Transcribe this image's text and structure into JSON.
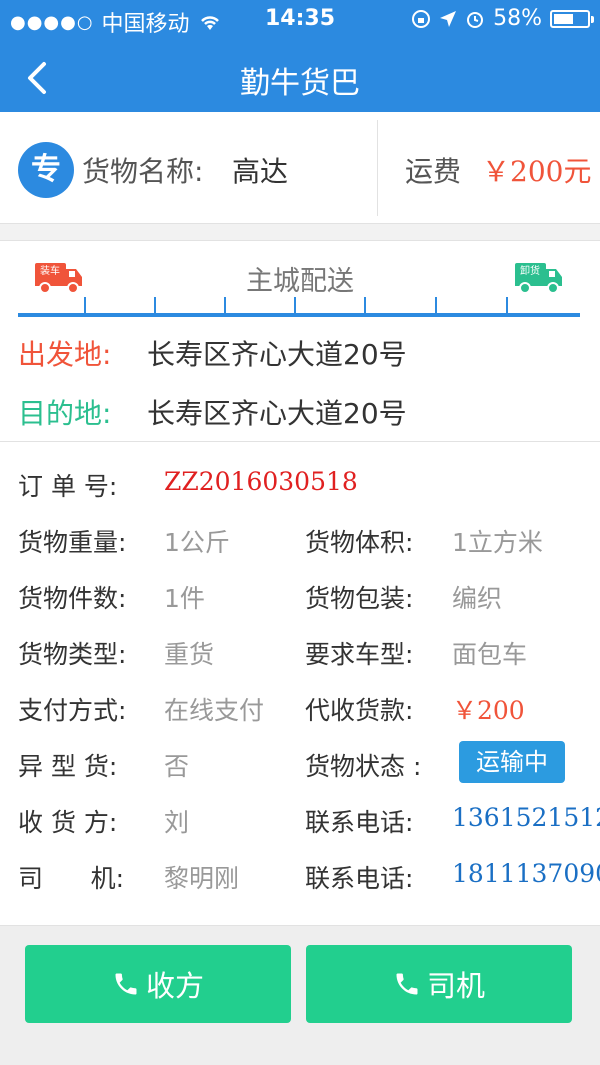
{
  "status_bar": {
    "carrier": "中国移动",
    "time": "14:35",
    "battery_text": "58%",
    "battery_level": 0.58
  },
  "nav": {
    "title": "勤牛货巴"
  },
  "summary": {
    "badge": "专",
    "goods_label": "货物名称:",
    "goods_name": "高达",
    "fee_label": "运费",
    "fee_value": "￥200元"
  },
  "route": {
    "load_label": "装车",
    "unload_label": "卸货",
    "delivery_type": "主城配送",
    "from_label": "出发地:",
    "from_value": "长寿区齐心大道20号",
    "to_label": "目的地:",
    "to_value": "长寿区齐心大道20号"
  },
  "info": {
    "order_label": "订 单 号:",
    "order_value": "ZZ2016030518",
    "weight_label": "货物重量:",
    "weight_value": "1公斤",
    "volume_label": "货物体积:",
    "volume_value": "1立方米",
    "count_label": "货物件数:",
    "count_value": "1件",
    "package_label": "货物包装:",
    "package_value": "编织",
    "type_label": "货物类型:",
    "type_value": "重货",
    "vehicle_label": "要求车型:",
    "vehicle_value": "面包车",
    "pay_label": "支付方式:",
    "pay_value": "在线支付",
    "cod_label": "代收货款:",
    "cod_value": "￥200",
    "odd_label": "异 型 货:",
    "odd_value": "否",
    "status_label": "货物状态 :",
    "status_value": "运输中",
    "receiver_label": "收 货 方:",
    "receiver_value": "刘",
    "receiver_phone_label": "联系电话:",
    "receiver_phone": "1361521512",
    "driver_label": "司      机:",
    "driver_value": "黎明刚",
    "driver_phone_label": "联系电话:",
    "driver_phone": "1811137090"
  },
  "actions": {
    "receiver_button": "收方",
    "driver_button": "司机"
  },
  "colors": {
    "primary": "#2c8ae0",
    "accent_red": "#f0543a",
    "accent_green": "#2bbf8f",
    "button_green": "#22cf8e"
  }
}
